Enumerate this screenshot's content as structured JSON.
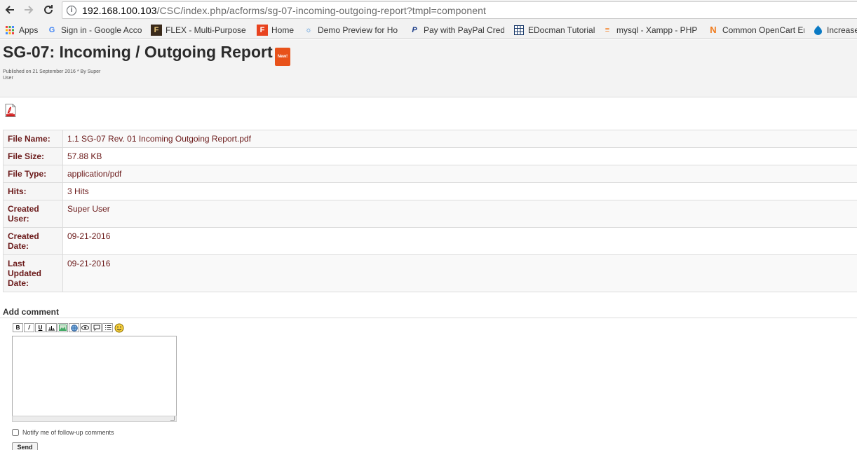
{
  "browser": {
    "url_host": "192.168.100.103",
    "url_path": "/CSC/index.php/acforms/sg-07-incoming-outgoing-report?tmpl=component",
    "bookmarks": [
      {
        "label": "Apps",
        "icon": "apps-grid-icon"
      },
      {
        "label": "Sign in - Google Acco",
        "icon": "google-icon"
      },
      {
        "label": "FLEX - Multi-Purpose",
        "icon": "flex-theme-icon"
      },
      {
        "label": "Home",
        "icon": "home-shield-icon"
      },
      {
        "label": "Demo Preview for Ho",
        "icon": "demo-preview-icon"
      },
      {
        "label": "Pay with PayPal Credit",
        "icon": "paypal-icon"
      },
      {
        "label": "EDocman Tutorial",
        "icon": "edocman-icon"
      },
      {
        "label": "mysql - Xampp - PHP",
        "icon": "stackoverflow-icon"
      },
      {
        "label": "Common OpenCart Er",
        "icon": "opencart-icon"
      },
      {
        "label": "Increase",
        "icon": "drupal-icon"
      }
    ]
  },
  "article": {
    "title": "SG-07: Incoming / Outgoing Report",
    "badge": "New!",
    "published_line1": "Published on 21 September 2016 * By Super",
    "published_line2": "User"
  },
  "details": {
    "rows": [
      {
        "label": "File Name:",
        "value": "1.1 SG-07 Rev. 01 Incoming Outgoing Report.pdf"
      },
      {
        "label": "File Size:",
        "value": "57.88 KB"
      },
      {
        "label": "File Type:",
        "value": "application/pdf"
      },
      {
        "label": "Hits:",
        "value": "3 Hits"
      },
      {
        "label": "Created User:",
        "value": "Super User"
      },
      {
        "label": "Created Date:",
        "value": "09-21-2016"
      },
      {
        "label": "Last Updated Date:",
        "value": "09-21-2016"
      }
    ]
  },
  "comments": {
    "heading": "Add comment",
    "toolbar": [
      "B",
      "I",
      "U",
      "S",
      "img",
      "url",
      "quote",
      "code",
      "list",
      "smile"
    ],
    "notify_label": "Notify me of follow-up comments",
    "send_label": "Send"
  }
}
